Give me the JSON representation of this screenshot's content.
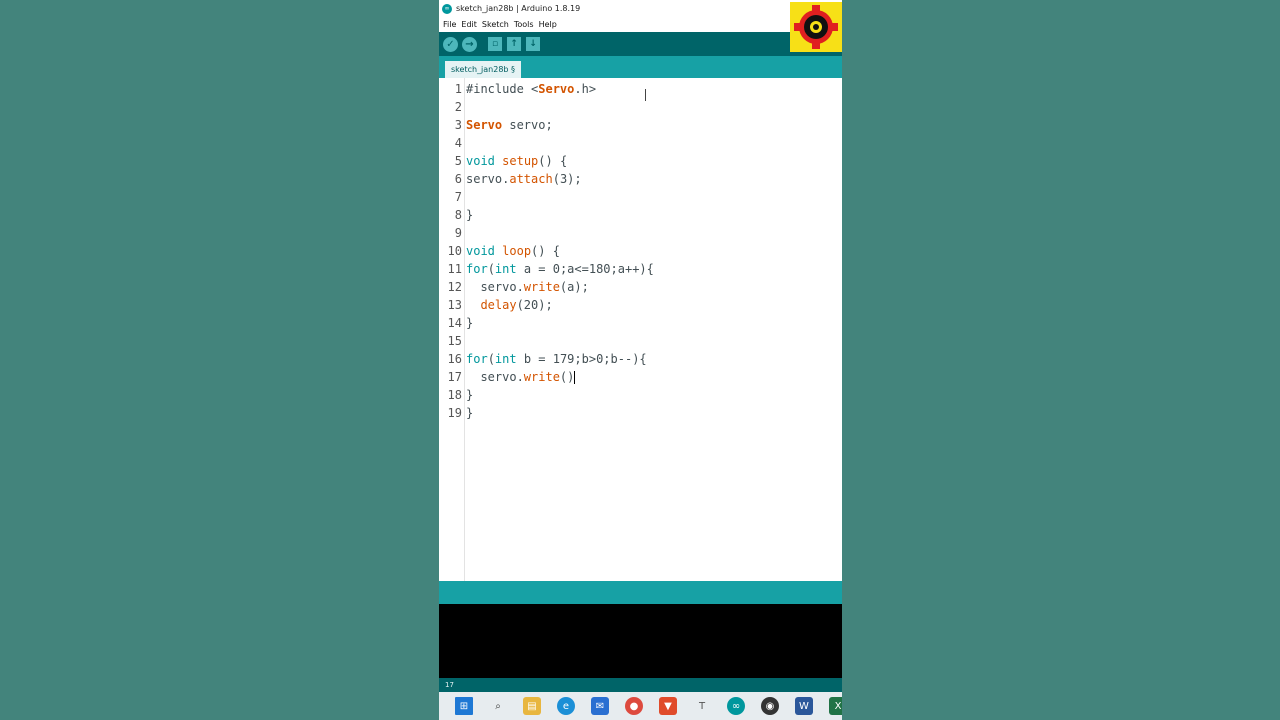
{
  "window": {
    "title": "sketch_jan28b | Arduino 1.8.19"
  },
  "menu": {
    "items": [
      "File",
      "Edit",
      "Sketch",
      "Tools",
      "Help"
    ]
  },
  "toolbar": {
    "buttons": [
      "verify-icon",
      "upload-icon",
      "new-icon",
      "open-icon",
      "save-icon"
    ]
  },
  "tabs": [
    {
      "label": "sketch_jan28b §"
    }
  ],
  "editor": {
    "cursor_line": 17
  },
  "footer": {
    "line_indicator": "17"
  },
  "taskbar": {
    "icons": [
      "start-icon",
      "search-icon",
      "file-explorer-icon",
      "edge-icon",
      "mail-icon",
      "chrome-icon",
      "brave-icon",
      "text-app-icon",
      "arduino-icon",
      "screen-recorder-icon",
      "word-icon",
      "excel-icon"
    ]
  },
  "colors": {
    "toolbar": "#006468",
    "tabstrip": "#17a1a5",
    "keyword": "#00979c",
    "function": "#d35400",
    "background": "#43847c",
    "badge": "#f7e017"
  }
}
